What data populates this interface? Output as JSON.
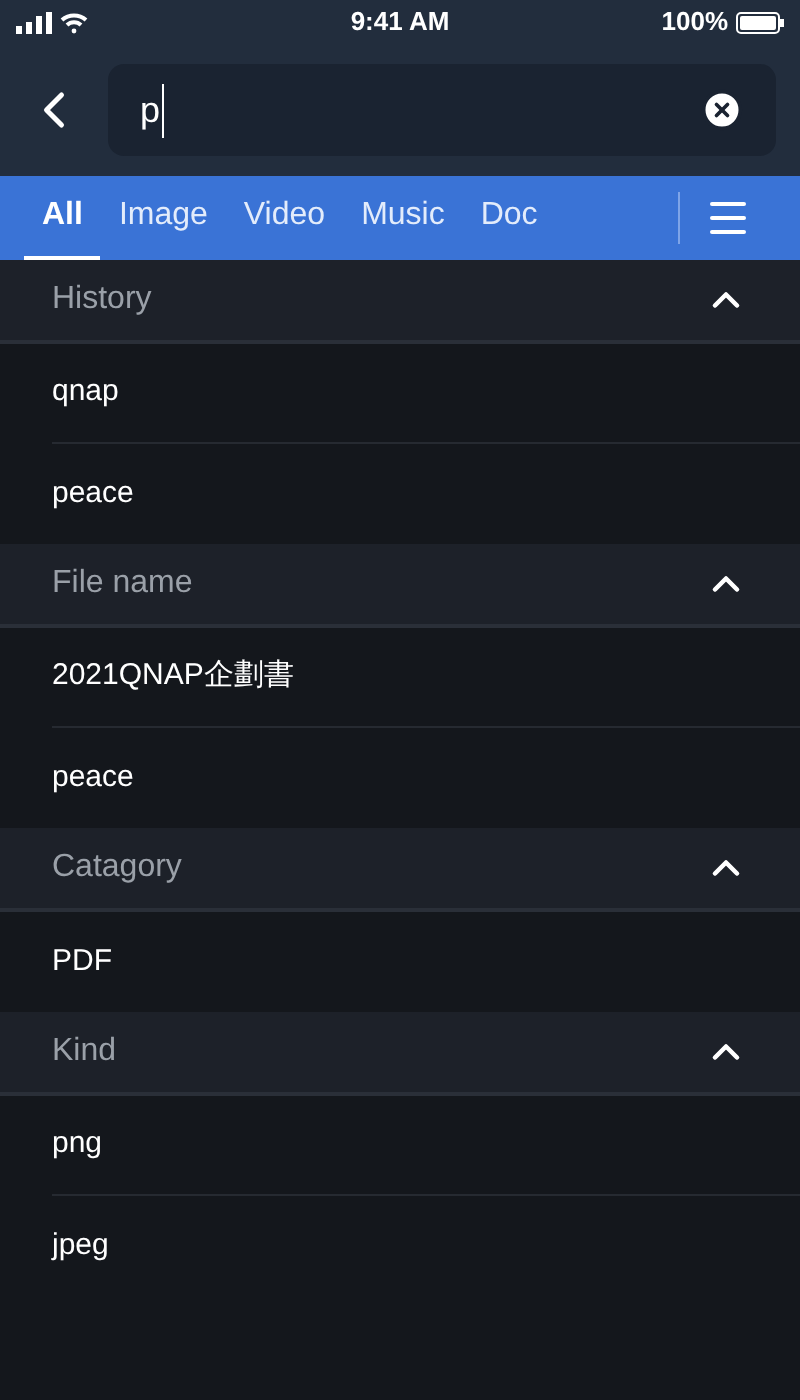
{
  "status_bar": {
    "time": "9:41 AM",
    "battery": "100%"
  },
  "search": {
    "value": "p"
  },
  "tabs": [
    {
      "label": "All",
      "selected": true
    },
    {
      "label": "Image",
      "selected": false
    },
    {
      "label": "Video",
      "selected": false
    },
    {
      "label": "Music",
      "selected": false
    },
    {
      "label": "Doc",
      "selected": false
    }
  ],
  "sections": [
    {
      "title": "History",
      "expanded": true,
      "items": [
        "qnap",
        "peace"
      ]
    },
    {
      "title": "File name",
      "expanded": true,
      "items": [
        "2021QNAP企劃書",
        "peace"
      ]
    },
    {
      "title": "Catagory",
      "expanded": true,
      "items": [
        "PDF"
      ]
    },
    {
      "title": "Kind",
      "expanded": true,
      "items": [
        "png",
        "jpeg"
      ]
    }
  ]
}
